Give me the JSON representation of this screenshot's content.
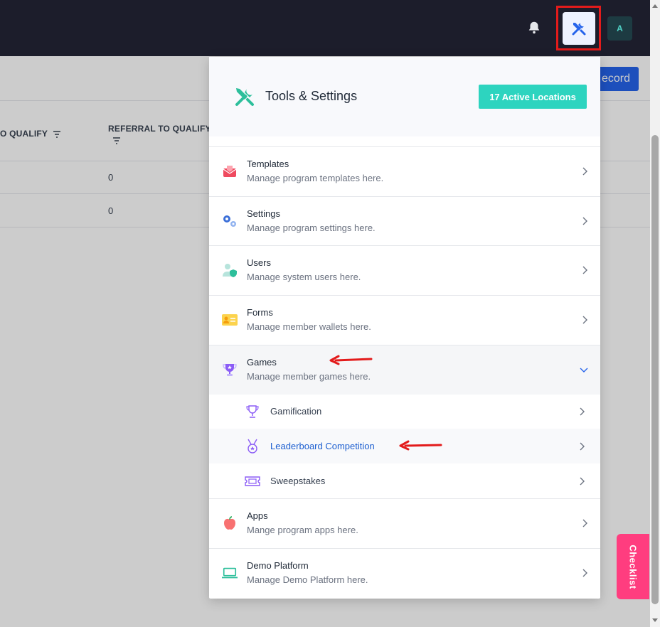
{
  "navbar": {
    "avatar_initial": "A"
  },
  "background": {
    "record_button": "ecord",
    "columns": [
      {
        "label": "O QUALIFY"
      },
      {
        "label": "REFERRAL TO QUALIFY"
      }
    ],
    "rows": [
      {
        "referral_to_qualify": "0"
      },
      {
        "referral_to_qualify": "0"
      }
    ]
  },
  "panel": {
    "title": "Tools & Settings",
    "active_locations": "17 Active Locations",
    "items": [
      {
        "title": "Templates",
        "desc": "Manage program templates here.",
        "icon": "envelope-icon"
      },
      {
        "title": "Settings",
        "desc": "Manage program settings here.",
        "icon": "gears-icon"
      },
      {
        "title": "Users",
        "desc": "Manage system users here.",
        "icon": "user-shield-icon"
      },
      {
        "title": "Forms",
        "desc": "Manage member wallets here.",
        "icon": "id-card-icon"
      },
      {
        "title": "Games",
        "desc": "Manage member games here.",
        "icon": "trophy-icon"
      },
      {
        "title": "Apps",
        "desc": "Mange program apps here.",
        "icon": "apple-icon"
      },
      {
        "title": "Demo Platform",
        "desc": "Manage Demo Platform here.",
        "icon": "laptop-icon"
      }
    ],
    "games_subitems": [
      {
        "label": "Gamification",
        "icon": "trophy-outline-icon"
      },
      {
        "label": "Leaderboard Competition",
        "icon": "medal-icon"
      },
      {
        "label": "Sweepstakes",
        "icon": "ticket-icon"
      }
    ]
  },
  "checklist_label": "Checklist",
  "colors": {
    "navbar": "#1c1d2b",
    "accent_teal": "#2dd4bf",
    "highlight_red": "#e31b1b",
    "active_link": "#1d5fd0",
    "checklist_pink": "#ff3d7f"
  }
}
